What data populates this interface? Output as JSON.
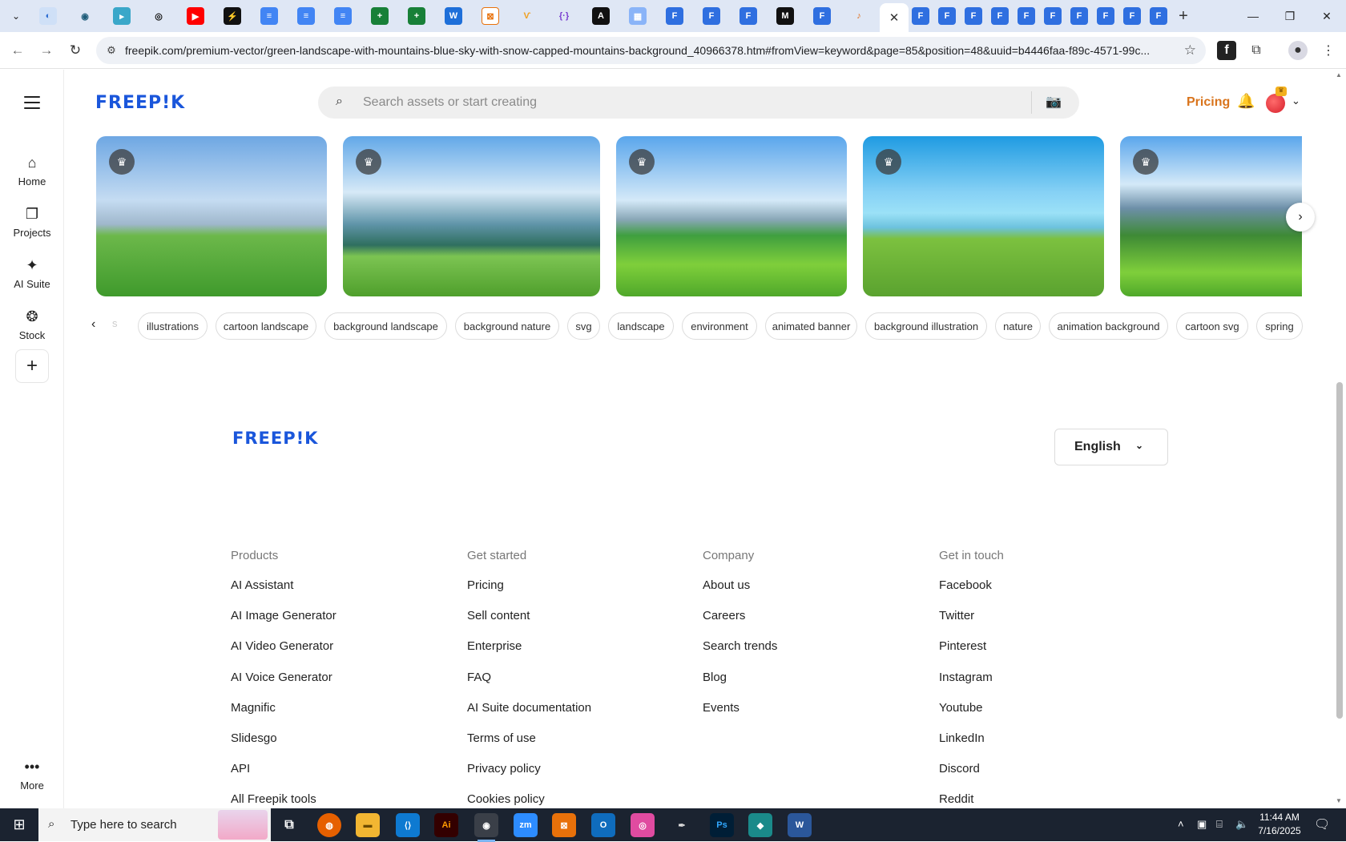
{
  "browser": {
    "url": "freepik.com/premium-vector/green-landscape-with-mountains-blue-sky-with-snow-capped-mountains-background_40966378.htm#fromView=keyword&page=85&position=48&uuid=b4446faa-f89c-4571-99c...",
    "active_tab_close": "✕",
    "new_tab": "+"
  },
  "header": {
    "logo": "FREEP!K",
    "search_placeholder": "Search assets or start creating",
    "pricing": "Pricing"
  },
  "rail": {
    "items": [
      {
        "label": "Home",
        "icon": "home-icon"
      },
      {
        "label": "Projects",
        "icon": "projects-icon"
      },
      {
        "label": "AI Suite",
        "icon": "sparkle-icon"
      },
      {
        "label": "Stock",
        "icon": "stock-icon"
      }
    ],
    "more": "More"
  },
  "tags": {
    "partial": "s",
    "items": [
      "illustrations",
      "cartoon landscape",
      "background landscape",
      "background nature",
      "svg",
      "landscape",
      "environment",
      "animated banner",
      "background illustration",
      "nature",
      "animation background",
      "cartoon svg",
      "spring"
    ]
  },
  "footer": {
    "logo": "FREEP!K",
    "language": "English",
    "columns": [
      {
        "heading": "Products",
        "links": [
          "AI Assistant",
          "AI Image Generator",
          "AI Video Generator",
          "AI Voice Generator",
          "Magnific",
          "Slidesgo",
          "API",
          "All Freepik tools"
        ]
      },
      {
        "heading": "Get started",
        "links": [
          "Pricing",
          "Sell content",
          "Enterprise",
          "FAQ",
          "AI Suite documentation",
          "Terms of use",
          "Privacy policy",
          "Cookies policy"
        ]
      },
      {
        "heading": "Company",
        "links": [
          "About us",
          "Careers",
          "Search trends",
          "Blog",
          "Events"
        ]
      },
      {
        "heading": "Get in touch",
        "links": [
          "Facebook",
          "Twitter",
          "Pinterest",
          "Instagram",
          "Youtube",
          "LinkedIn",
          "Discord",
          "Reddit"
        ]
      }
    ]
  },
  "taskbar": {
    "search_placeholder": "Type here to search",
    "time": "11:44 AM",
    "date": "7/16/2025"
  },
  "colors": {
    "brand_blue": "#1a56db",
    "pricing_orange": "#d9741c"
  }
}
